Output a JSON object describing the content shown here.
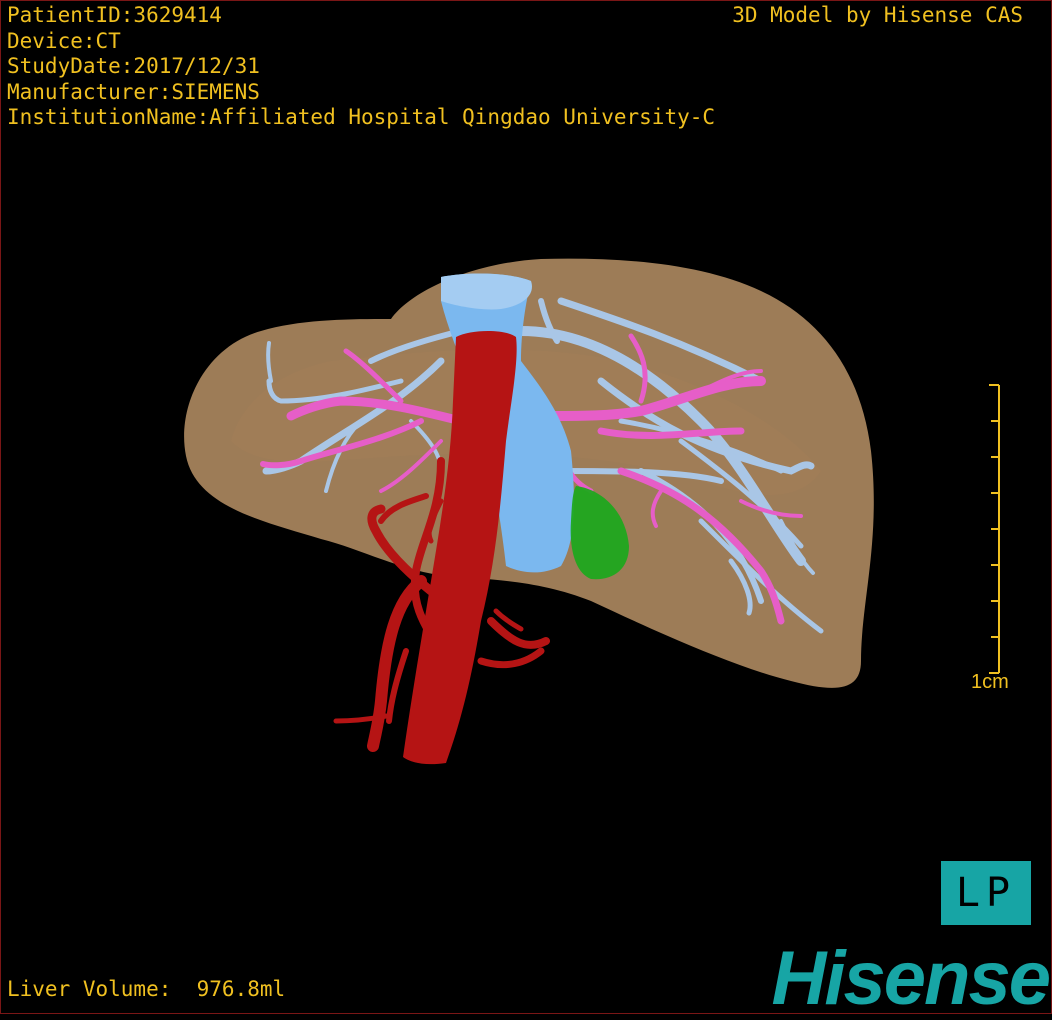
{
  "header": {
    "patient_id": "PatientID:3629414",
    "device": "Device:CT",
    "study_date": "StudyDate:2017/12/31",
    "manufacturer": "Manufacturer:SIEMENS",
    "institution": "InstitutionName:Affiliated Hospital Qingdao University-C"
  },
  "credit": "3D Model by Hisense CAS",
  "footer": {
    "liver_volume": "Liver Volume:  976.8ml"
  },
  "scale_bar": {
    "label": "1cm",
    "color": "#f0c020"
  },
  "orientation": {
    "label": "LP",
    "color": "#17a5a5"
  },
  "brand": {
    "name": "Hisense",
    "color": "#17a5a5"
  },
  "colors": {
    "text": "#f0c020",
    "liver": "#b38d63",
    "artery": "#b51414",
    "portal_vein": "#e65ec8",
    "hepatic_vein": "#a9c6e6",
    "ivc": "#7bb8ef",
    "gallbladder": "#1fa81f",
    "background": "#000000"
  }
}
